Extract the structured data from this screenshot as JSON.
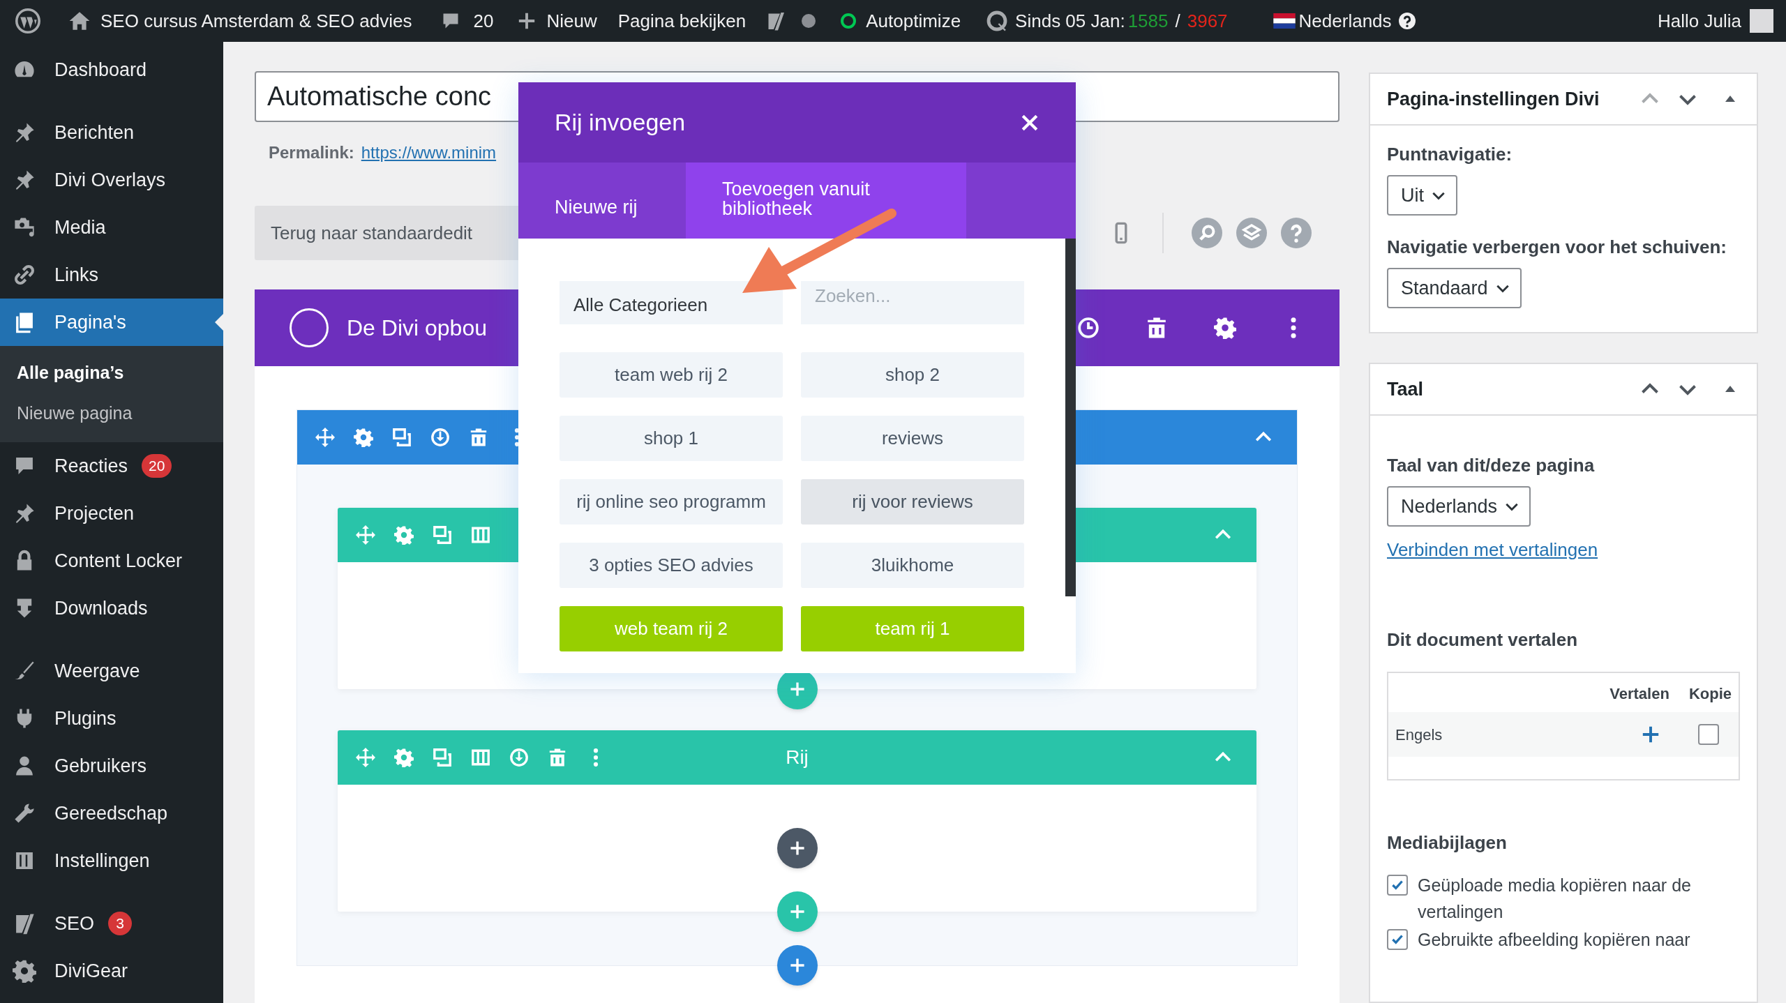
{
  "admin_bar": {
    "site_name": "SEO cursus Amsterdam & SEO advies",
    "comments": "20",
    "new": "Nieuw",
    "view": "Pagina bekijken",
    "autoptimize": "Autoptimize",
    "stats_label": "Sinds 05 Jan:",
    "stats_visitors": "1585",
    "stats_separator": "/",
    "stats_views": "3967",
    "language": "Nederlands",
    "greeting": "Hallo Julia"
  },
  "sidebar": {
    "groups": [
      [
        {
          "label": "Dashboard",
          "selected": false
        }
      ],
      [
        {
          "label": "Berichten",
          "selected": false
        },
        {
          "label": "Divi Overlays",
          "selected": false
        },
        {
          "label": "Media",
          "selected": false
        },
        {
          "label": "Links",
          "selected": false
        },
        {
          "label": "Pagina's",
          "selected": true,
          "children": [
            {
              "label": "Alle pagina’s",
              "selected": true
            },
            {
              "label": "Nieuwe pagina",
              "selected": false
            }
          ]
        },
        {
          "label": "Reacties",
          "selected": false,
          "badge": "20"
        },
        {
          "label": "Projecten",
          "selected": false
        },
        {
          "label": "Content Locker",
          "selected": false
        },
        {
          "label": "Downloads",
          "selected": false
        }
      ],
      [
        {
          "label": "Weergave",
          "selected": false
        },
        {
          "label": "Plugins",
          "selected": false
        },
        {
          "label": "Gebruikers",
          "selected": false
        },
        {
          "label": "Gereedschap",
          "selected": false
        },
        {
          "label": "Instellingen",
          "selected": false
        }
      ],
      [
        {
          "label": "SEO",
          "selected": false,
          "badge": "3"
        },
        {
          "label": "DiviGear",
          "selected": false
        }
      ]
    ]
  },
  "editor": {
    "title": "Automatische conc",
    "permalink_label": "Permalink:",
    "permalink_url": "https://www.minim",
    "back_button": "Terug naar standaardedit"
  },
  "builder": {
    "title": "De Divi opbou",
    "section": {
      "expanded": true,
      "rows": [
        {
          "expanded": true
        },
        {
          "expanded": true,
          "label": "Rij"
        }
      ]
    }
  },
  "modal": {
    "title": "Rij invoegen",
    "tabs": [
      {
        "label": "Nieuwe rij",
        "selected": false
      },
      {
        "label": "Toevoegen vanuit bibliotheek",
        "selected": true
      }
    ],
    "category": "Alle Categorieen",
    "search_placeholder": "Zoeken...",
    "layouts": [
      {
        "label": "team web rij 2",
        "global": false,
        "hovered": false
      },
      {
        "label": "shop 2",
        "global": false,
        "hovered": false
      },
      {
        "label": "shop 1",
        "global": false,
        "hovered": false
      },
      {
        "label": "reviews",
        "global": false,
        "hovered": false
      },
      {
        "label": "rij online seo programm",
        "global": false,
        "hovered": false
      },
      {
        "label": "rij voor reviews",
        "global": false,
        "hovered": true
      },
      {
        "label": "3 opties SEO advies",
        "global": false,
        "hovered": false
      },
      {
        "label": "3luikhome",
        "global": false,
        "hovered": false
      },
      {
        "label": "web team rij 2",
        "global": true,
        "hovered": false
      },
      {
        "label": "team rij 1",
        "global": true,
        "hovered": false
      }
    ]
  },
  "panels": [
    {
      "title": "Pagina-instellingen Divi",
      "up_disabled": true,
      "fields": [
        {
          "kind": "select",
          "label": "Puntnavigatie:",
          "value": "Uit"
        },
        {
          "kind": "select",
          "label": "Navigatie verbergen voor het schuiven:",
          "value": "Standaard"
        }
      ]
    },
    {
      "title": "Taal",
      "up_disabled": false,
      "fields": [
        {
          "kind": "select",
          "label": "Taal van dit/deze pagina",
          "value": "Nederlands"
        },
        {
          "kind": "link",
          "label": "Verbinden met vertalingen"
        },
        {
          "kind": "translations",
          "label": "Dit document vertalen",
          "columns": [
            "Vertalen",
            "Kopie"
          ],
          "rows": [
            {
              "language": "Engels",
              "copy_checked": false
            }
          ]
        },
        {
          "kind": "checkboxes",
          "label": "Mediabijlagen",
          "items": [
            {
              "label": "Geüploade media kopiëren naar de vertalingen",
              "checked": true
            },
            {
              "label": "Gebruikte afbeelding kopiëren naar",
              "checked": true
            }
          ]
        }
      ]
    }
  ]
}
